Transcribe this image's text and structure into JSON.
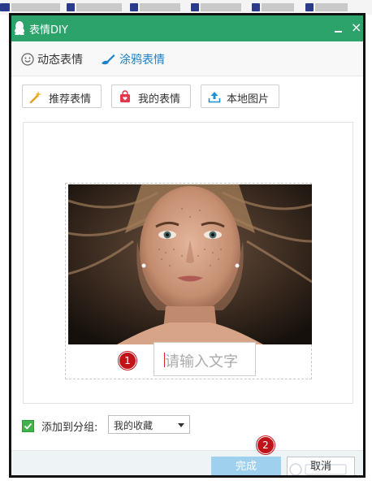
{
  "window": {
    "title": "表情DIY"
  },
  "modes": [
    {
      "label": "动态表情",
      "icon": "smiley-icon"
    },
    {
      "label": "涂鸦表情",
      "icon": "brush-icon"
    }
  ],
  "toolbar": {
    "recommend_label": "推荐表情",
    "mine_label": "我的表情",
    "local_label": "本地图片"
  },
  "editor": {
    "text_placeholder": "请输入文字"
  },
  "annotations": {
    "step1": "1",
    "step2": "2"
  },
  "group": {
    "add_label": "添加到分组:",
    "checked": true,
    "selected": "我的收藏"
  },
  "footer": {
    "done_label": "完成",
    "cancel_label": "取消"
  },
  "colors": {
    "titlebar": "#2ca36b",
    "accent_blue": "#1b7fc9",
    "done_button": "#9fd1ef",
    "badge_red": "#c0141a",
    "checkbox_green": "#3fb24a"
  }
}
